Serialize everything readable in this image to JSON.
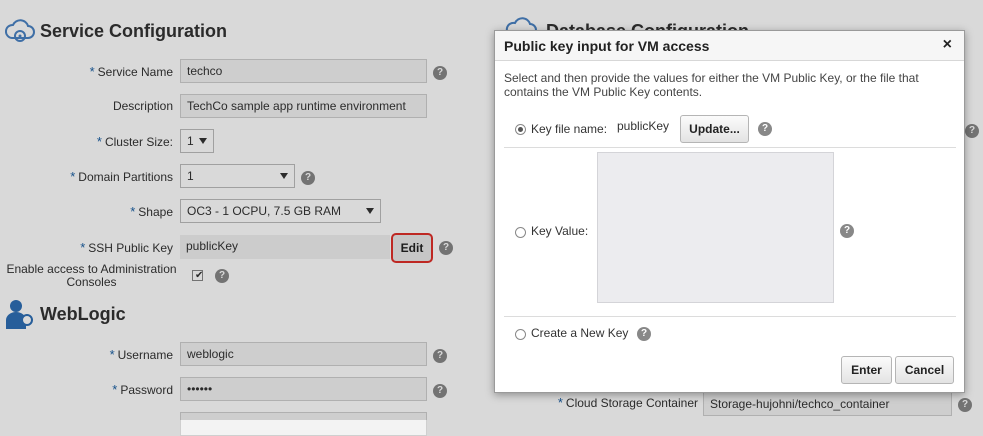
{
  "service": {
    "title": "Service Configuration",
    "fields": {
      "service_name": {
        "label": "Service Name",
        "value": "techco"
      },
      "description": {
        "label": "Description",
        "value": "TechCo sample app runtime environment"
      },
      "cluster_size": {
        "label": "Cluster Size:",
        "value": "1"
      },
      "domain_partitions": {
        "label": "Domain Partitions",
        "value": "1"
      },
      "shape": {
        "label": "Shape",
        "value": "OC3 - 1 OCPU, 7.5 GB RAM"
      },
      "ssh_key": {
        "label": "SSH Public Key",
        "value": "publicKey",
        "edit_label": "Edit"
      },
      "admin_access": {
        "label_line1": "Enable access to Administration",
        "label_line2": "Consoles",
        "checked": true
      }
    }
  },
  "weblogic": {
    "title": "WebLogic",
    "fields": {
      "username": {
        "label": "Username",
        "value": "weblogic"
      },
      "password": {
        "label": "Password",
        "value": "••••••"
      }
    }
  },
  "database": {
    "title": "Database Configuration",
    "cloud_storage": {
      "label": "Cloud Storage Container",
      "value": "Storage-hujohni/techco_container"
    }
  },
  "dialog": {
    "title": "Public key input for VM access",
    "close": "×",
    "description": "Select and then provide the values for either the VM Public Key, or the file that contains the VM Public Key contents.",
    "key_file": {
      "label": "Key file name:",
      "value": "publicKey",
      "update_label": "Update...",
      "selected": true
    },
    "key_value": {
      "label": "Key Value:",
      "value": ""
    },
    "create_new": {
      "label": "Create a New Key"
    },
    "enter_label": "Enter",
    "cancel_label": "Cancel"
  },
  "icons": {
    "help": "?",
    "required": "*",
    "checkbox_tick": "✔"
  }
}
